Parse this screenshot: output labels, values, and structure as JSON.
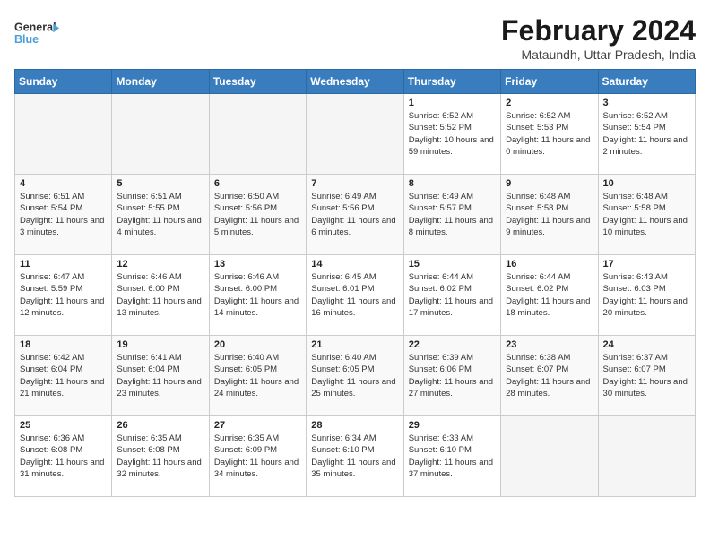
{
  "logo": {
    "line1": "General",
    "line2": "Blue"
  },
  "title": "February 2024",
  "location": "Mataundh, Uttar Pradesh, India",
  "days_of_week": [
    "Sunday",
    "Monday",
    "Tuesday",
    "Wednesday",
    "Thursday",
    "Friday",
    "Saturday"
  ],
  "weeks": [
    [
      {
        "day": "",
        "info": ""
      },
      {
        "day": "",
        "info": ""
      },
      {
        "day": "",
        "info": ""
      },
      {
        "day": "",
        "info": ""
      },
      {
        "day": "1",
        "info": "Sunrise: 6:52 AM\nSunset: 5:52 PM\nDaylight: 10 hours and 59 minutes."
      },
      {
        "day": "2",
        "info": "Sunrise: 6:52 AM\nSunset: 5:53 PM\nDaylight: 11 hours and 0 minutes."
      },
      {
        "day": "3",
        "info": "Sunrise: 6:52 AM\nSunset: 5:54 PM\nDaylight: 11 hours and 2 minutes."
      }
    ],
    [
      {
        "day": "4",
        "info": "Sunrise: 6:51 AM\nSunset: 5:54 PM\nDaylight: 11 hours and 3 minutes."
      },
      {
        "day": "5",
        "info": "Sunrise: 6:51 AM\nSunset: 5:55 PM\nDaylight: 11 hours and 4 minutes."
      },
      {
        "day": "6",
        "info": "Sunrise: 6:50 AM\nSunset: 5:56 PM\nDaylight: 11 hours and 5 minutes."
      },
      {
        "day": "7",
        "info": "Sunrise: 6:49 AM\nSunset: 5:56 PM\nDaylight: 11 hours and 6 minutes."
      },
      {
        "day": "8",
        "info": "Sunrise: 6:49 AM\nSunset: 5:57 PM\nDaylight: 11 hours and 8 minutes."
      },
      {
        "day": "9",
        "info": "Sunrise: 6:48 AM\nSunset: 5:58 PM\nDaylight: 11 hours and 9 minutes."
      },
      {
        "day": "10",
        "info": "Sunrise: 6:48 AM\nSunset: 5:58 PM\nDaylight: 11 hours and 10 minutes."
      }
    ],
    [
      {
        "day": "11",
        "info": "Sunrise: 6:47 AM\nSunset: 5:59 PM\nDaylight: 11 hours and 12 minutes."
      },
      {
        "day": "12",
        "info": "Sunrise: 6:46 AM\nSunset: 6:00 PM\nDaylight: 11 hours and 13 minutes."
      },
      {
        "day": "13",
        "info": "Sunrise: 6:46 AM\nSunset: 6:00 PM\nDaylight: 11 hours and 14 minutes."
      },
      {
        "day": "14",
        "info": "Sunrise: 6:45 AM\nSunset: 6:01 PM\nDaylight: 11 hours and 16 minutes."
      },
      {
        "day": "15",
        "info": "Sunrise: 6:44 AM\nSunset: 6:02 PM\nDaylight: 11 hours and 17 minutes."
      },
      {
        "day": "16",
        "info": "Sunrise: 6:44 AM\nSunset: 6:02 PM\nDaylight: 11 hours and 18 minutes."
      },
      {
        "day": "17",
        "info": "Sunrise: 6:43 AM\nSunset: 6:03 PM\nDaylight: 11 hours and 20 minutes."
      }
    ],
    [
      {
        "day": "18",
        "info": "Sunrise: 6:42 AM\nSunset: 6:04 PM\nDaylight: 11 hours and 21 minutes."
      },
      {
        "day": "19",
        "info": "Sunrise: 6:41 AM\nSunset: 6:04 PM\nDaylight: 11 hours and 23 minutes."
      },
      {
        "day": "20",
        "info": "Sunrise: 6:40 AM\nSunset: 6:05 PM\nDaylight: 11 hours and 24 minutes."
      },
      {
        "day": "21",
        "info": "Sunrise: 6:40 AM\nSunset: 6:05 PM\nDaylight: 11 hours and 25 minutes."
      },
      {
        "day": "22",
        "info": "Sunrise: 6:39 AM\nSunset: 6:06 PM\nDaylight: 11 hours and 27 minutes."
      },
      {
        "day": "23",
        "info": "Sunrise: 6:38 AM\nSunset: 6:07 PM\nDaylight: 11 hours and 28 minutes."
      },
      {
        "day": "24",
        "info": "Sunrise: 6:37 AM\nSunset: 6:07 PM\nDaylight: 11 hours and 30 minutes."
      }
    ],
    [
      {
        "day": "25",
        "info": "Sunrise: 6:36 AM\nSunset: 6:08 PM\nDaylight: 11 hours and 31 minutes."
      },
      {
        "day": "26",
        "info": "Sunrise: 6:35 AM\nSunset: 6:08 PM\nDaylight: 11 hours and 32 minutes."
      },
      {
        "day": "27",
        "info": "Sunrise: 6:35 AM\nSunset: 6:09 PM\nDaylight: 11 hours and 34 minutes."
      },
      {
        "day": "28",
        "info": "Sunrise: 6:34 AM\nSunset: 6:10 PM\nDaylight: 11 hours and 35 minutes."
      },
      {
        "day": "29",
        "info": "Sunrise: 6:33 AM\nSunset: 6:10 PM\nDaylight: 11 hours and 37 minutes."
      },
      {
        "day": "",
        "info": ""
      },
      {
        "day": "",
        "info": ""
      }
    ]
  ]
}
